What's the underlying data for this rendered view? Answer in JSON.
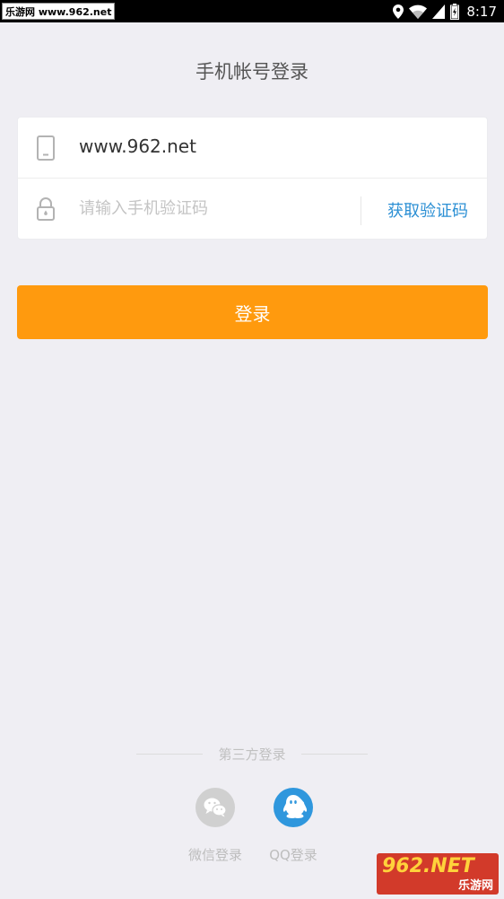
{
  "status_bar": {
    "watermark": "乐游网 www.962.net",
    "time": "8:17",
    "icons": [
      "location-icon",
      "wifi-icon",
      "signal-icon",
      "battery-icon"
    ]
  },
  "page": {
    "title": "手机帐号登录"
  },
  "form": {
    "phone_value": "www.962.net",
    "phone_icon": "phone-icon",
    "code_placeholder": "请输入手机验证码",
    "code_icon": "lock-icon",
    "get_code_label": "获取验证码"
  },
  "login_button": {
    "label": "登录",
    "color": "#ff9a0e"
  },
  "third_party": {
    "header": "第三方登录",
    "options": [
      {
        "label": "微信登录",
        "icon": "wechat-icon",
        "color": "#d0d0d0"
      },
      {
        "label": "QQ登录",
        "icon": "qq-icon",
        "color": "#2f97dd"
      }
    ]
  },
  "corner_logo": {
    "main": "962.NET",
    "sub": "乐游网"
  }
}
